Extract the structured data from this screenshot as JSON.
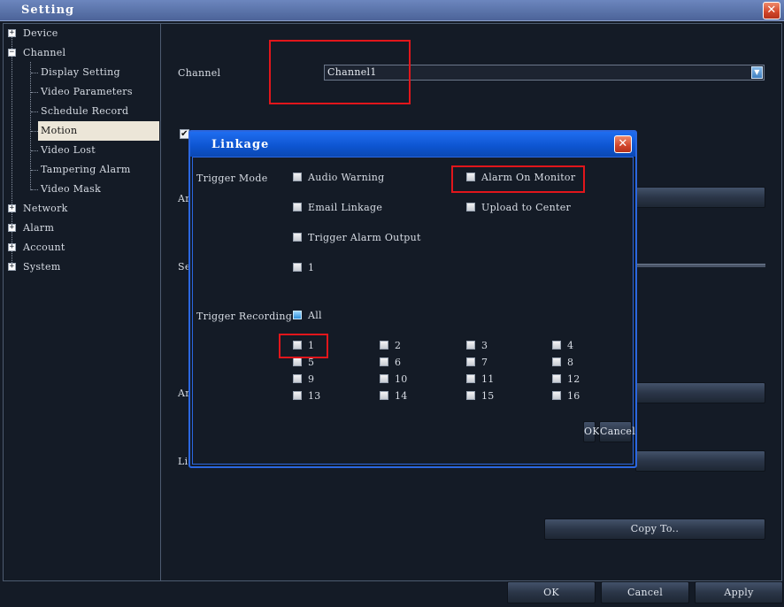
{
  "window": {
    "title": "Setting",
    "close_glyph": "✕"
  },
  "tree": {
    "items": [
      {
        "label": "Device",
        "toggle": "+"
      },
      {
        "label": "Channel",
        "toggle": "−"
      },
      {
        "label": "Display Setting"
      },
      {
        "label": "Video Parameters"
      },
      {
        "label": "Schedule Record"
      },
      {
        "label": "Motion",
        "selected": true
      },
      {
        "label": "Video Lost"
      },
      {
        "label": "Tampering Alarm"
      },
      {
        "label": "Video Mask"
      },
      {
        "label": "Network",
        "toggle": "+"
      },
      {
        "label": "Alarm",
        "toggle": "+"
      },
      {
        "label": "Account",
        "toggle": "+"
      },
      {
        "label": "System",
        "toggle": "+"
      }
    ]
  },
  "panel": {
    "channel_label": "Channel",
    "channel_value": "Channel1",
    "enable_check": "✔",
    "partial_labels": {
      "ar1": "Ar",
      "se": "Se",
      "ar2": "Ar",
      "li": "Li"
    },
    "copy_to": "Copy To.."
  },
  "dialog": {
    "title": "Linkage",
    "close_glyph": "✕",
    "trigger_mode_label": "Trigger Mode",
    "modes": {
      "audio_warning": "Audio Warning",
      "alarm_on_monitor": "Alarm On Monitor",
      "email_linkage": "Email Linkage",
      "upload_to_center": "Upload to Center",
      "trigger_alarm_output": "Trigger Alarm Output",
      "output_1": "1"
    },
    "trigger_recording_label": "Trigger Recording",
    "all_label": "All",
    "channels": [
      "1",
      "2",
      "3",
      "4",
      "5",
      "6",
      "7",
      "8",
      "9",
      "10",
      "11",
      "12",
      "13",
      "14",
      "15",
      "16"
    ],
    "ok": "OK",
    "cancel": "Cancel"
  },
  "footer": {
    "ok": "OK",
    "cancel": "Cancel",
    "apply": "Apply"
  },
  "colors": {
    "background": "#141b26",
    "dialog_border": "#2b67e0",
    "highlight": "#e1161b",
    "selected_node": "#ece6d8"
  }
}
